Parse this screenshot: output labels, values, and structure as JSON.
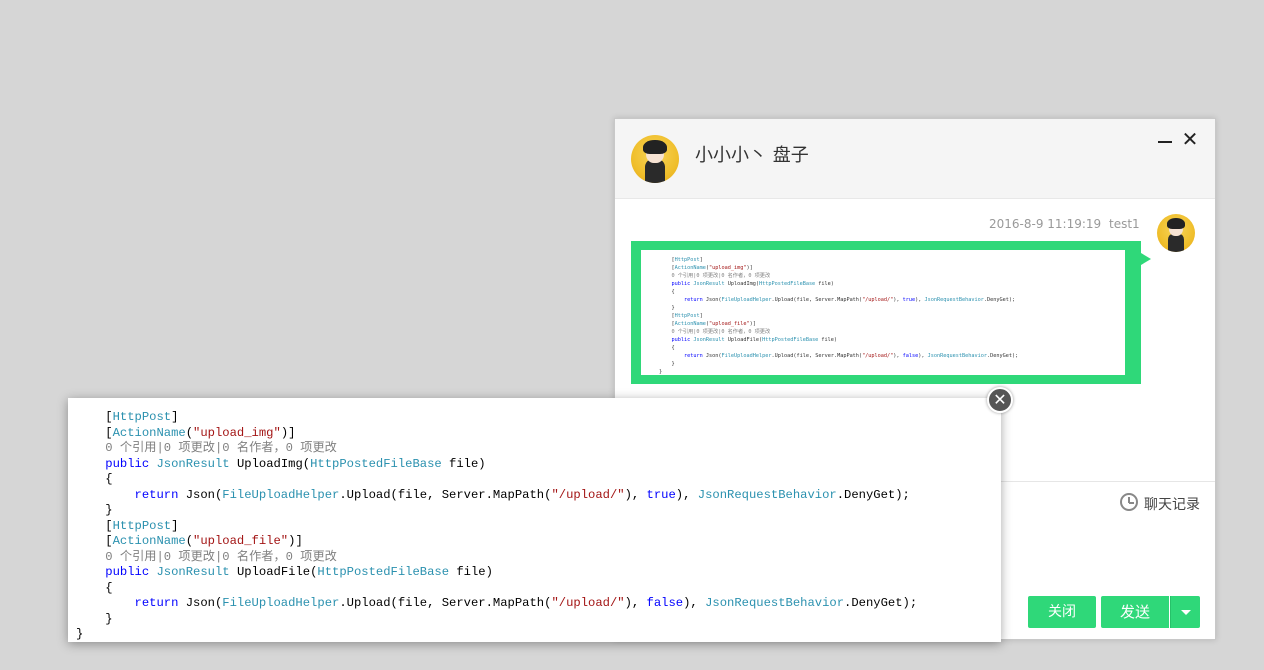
{
  "chat": {
    "contact_name": "小小小丶 盘子",
    "minimize_label": "—",
    "close_label": "✕",
    "message": {
      "time": "2016-8-9 11:19:19",
      "user": "test1"
    },
    "history_label": "聊天记录",
    "close_button": "关闭",
    "send_button": "发送"
  },
  "preview": {
    "close_label": "✕",
    "code_lines": [
      "    [HttpPost]",
      "    [ActionName(\"upload_img\")]",
      "    0 个引用|0 项更改|0 名作者，0 项更改",
      "    public JsonResult UploadImg(HttpPostedFileBase file)",
      "    {",
      "        return Json(FileUploadHelper.Upload(file, Server.MapPath(\"/upload/\"), true), JsonRequestBehavior.DenyGet);",
      "    }",
      "    [HttpPost]",
      "    [ActionName(\"upload_file\")]",
      "    0 个引用|0 项更改|0 名作者，0 项更改",
      "    public JsonResult UploadFile(HttpPostedFileBase file)",
      "    {",
      "        return Json(FileUploadHelper.Upload(file, Server.MapPath(\"/upload/\"), false), JsonRequestBehavior.DenyGet);",
      "    }",
      "}"
    ]
  }
}
